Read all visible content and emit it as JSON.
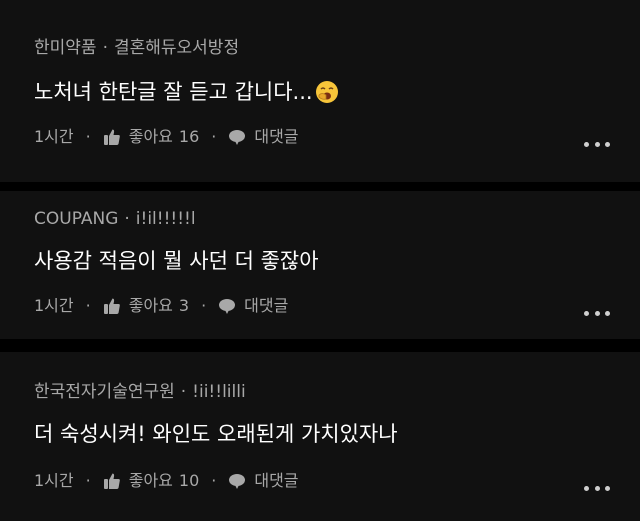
{
  "comments": [
    {
      "author": "한미약품",
      "subtitle": "결혼해듀오서방정",
      "text": "노처녀 한탄글 잘 듣고 갑니다...",
      "emoji": "yawning-face-emoji",
      "time": "1시간",
      "like_label": "좋아요",
      "like_count": "16",
      "reply_label": "대댓글"
    },
    {
      "author": "COUPANG",
      "subtitle": "i!il!!!!!l",
      "text": "사용감 적음이 뭘 사던 더 좋잖아",
      "time": "1시간",
      "like_label": "좋아요",
      "like_count": "3",
      "reply_label": "대댓글"
    },
    {
      "author": "한국전자기술연구원",
      "subtitle": "!ii!!lilli",
      "text": "더 숙성시켜! 와인도 오래된게 가치있자나",
      "time": "1시간",
      "like_label": "좋아요",
      "like_count": "10",
      "reply_label": "대댓글"
    }
  ],
  "separator": "·",
  "icons": {
    "like": "thumbs-up-icon",
    "reply": "speech-bubble-icon",
    "more": "more-options-icon"
  },
  "colors": {
    "background": "#000000",
    "card": "#111111",
    "meta_text": "#a8a8a8",
    "body_text": "#ffffff"
  }
}
